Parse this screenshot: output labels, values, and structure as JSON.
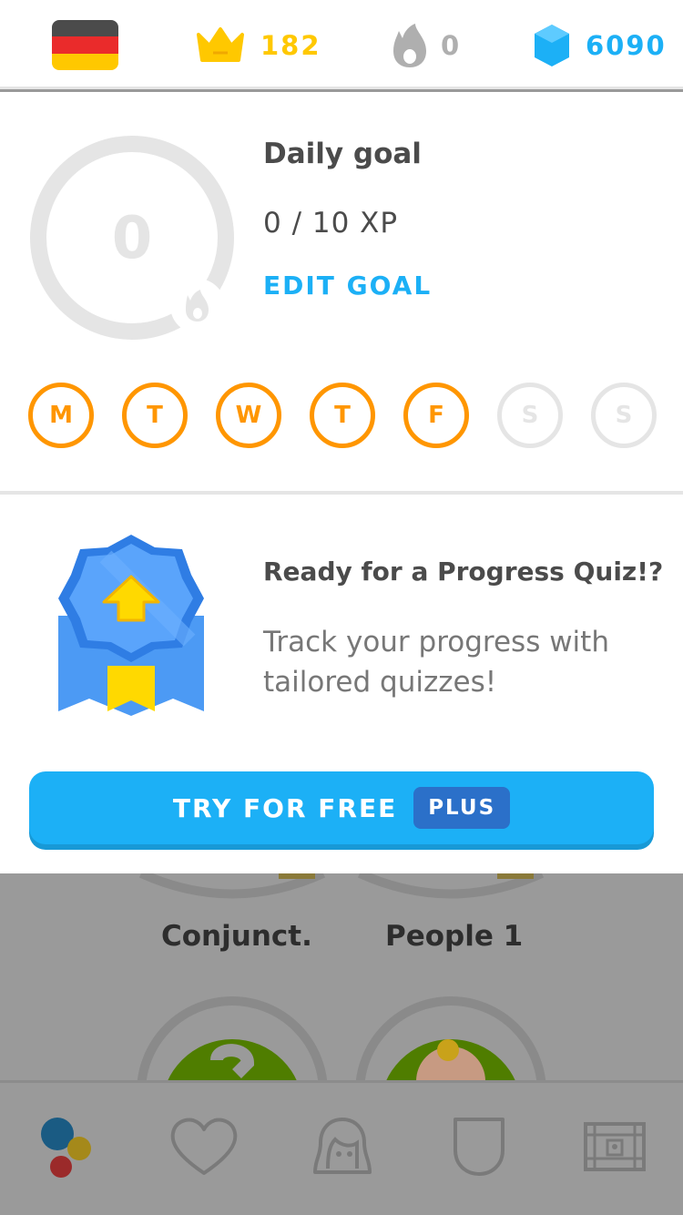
{
  "topbar": {
    "language_flag": "germany-flag",
    "crowns": "182",
    "streak": "0",
    "gems": "6090",
    "colors": {
      "crown": "#ffc800",
      "streak": "#afafaf",
      "gems": "#1cb0f6"
    }
  },
  "daily_goal": {
    "ring_value": "0",
    "title": "Daily goal",
    "progress_text": "0 / 10 XP",
    "edit_label": "EDIT GOAL",
    "progress_fraction": 0,
    "days": [
      {
        "letter": "M",
        "done": true
      },
      {
        "letter": "T",
        "done": true
      },
      {
        "letter": "W",
        "done": true
      },
      {
        "letter": "T",
        "done": true
      },
      {
        "letter": "F",
        "done": true
      },
      {
        "letter": "S",
        "done": false
      },
      {
        "letter": "S",
        "done": false
      }
    ]
  },
  "quiz_promo": {
    "title": "Ready for a Progress Quiz!?",
    "description": "Track your progress with tailored quizzes!",
    "button_label": "TRY FOR FREE",
    "plus_label": "PLUS",
    "colors": {
      "button": "#1cb0f6",
      "plus": "#2b70c9"
    }
  },
  "skill_tree": {
    "skills": [
      "Conjunct.",
      "People 1"
    ]
  },
  "bottom_nav": {
    "items": [
      "learn-icon",
      "heart-icon",
      "profile-icon",
      "shield-icon",
      "shop-icon"
    ]
  }
}
